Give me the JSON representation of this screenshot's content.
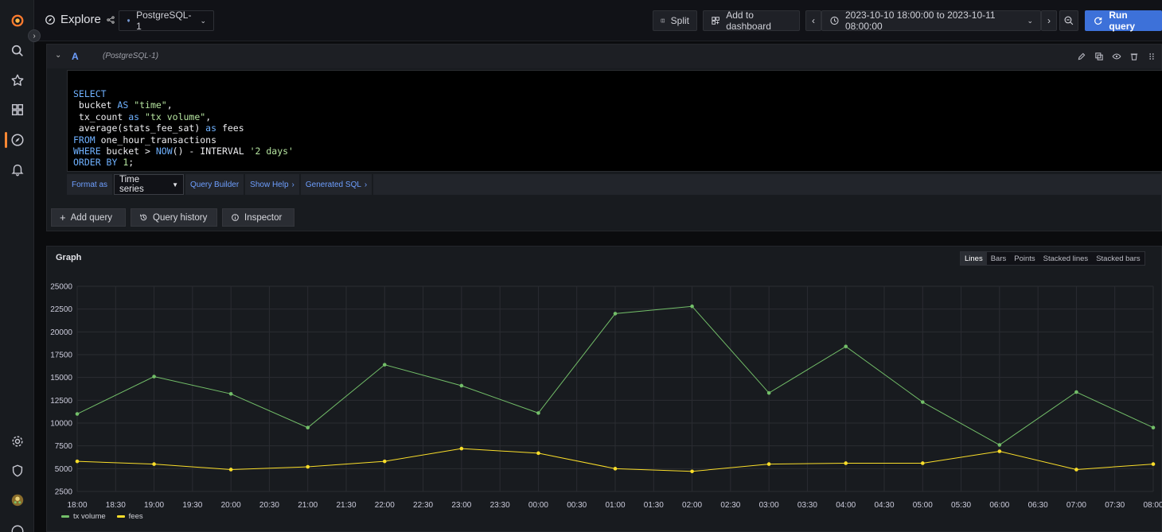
{
  "topbar": {
    "title": "Explore",
    "datasource": "PostgreSQL-1",
    "split_label": "Split",
    "add_dashboard_label": "Add to dashboard",
    "time_range": "2023-10-10 18:00:00 to 2023-10-11 08:00:00",
    "run_label": "Run query"
  },
  "query": {
    "ref_id": "A",
    "datasource_label": "(PostgreSQL-1)",
    "format_as_label": "Format as",
    "format_value": "Time series",
    "builder_label": "Query Builder",
    "help_label": "Show Help",
    "generated_sql_label": "Generated SQL",
    "add_query_label": "Add query",
    "history_label": "Query history",
    "inspector_label": "Inspector"
  },
  "graph": {
    "title": "Graph",
    "view_types": [
      "Lines",
      "Bars",
      "Points",
      "Stacked lines",
      "Stacked bars"
    ],
    "active_view": "Lines"
  },
  "colors": {
    "tx_volume": "#73bf69",
    "fees": "#fade2a",
    "accent": "#3d71d9"
  },
  "chart_data": {
    "type": "line",
    "x": [
      "18:00",
      "19:00",
      "20:00",
      "21:00",
      "22:00",
      "23:00",
      "00:00",
      "01:00",
      "02:00",
      "03:00",
      "04:00",
      "05:00",
      "06:00",
      "07:00",
      "08:00"
    ],
    "x_tick_labels": [
      "18:00",
      "18:30",
      "19:00",
      "19:30",
      "20:00",
      "20:30",
      "21:00",
      "21:30",
      "22:00",
      "22:30",
      "23:00",
      "23:30",
      "00:00",
      "00:30",
      "01:00",
      "01:30",
      "02:00",
      "02:30",
      "03:00",
      "03:30",
      "04:00",
      "04:30",
      "05:00",
      "05:30",
      "06:00",
      "06:30",
      "07:00",
      "07:30",
      "08:00"
    ],
    "y_ticks": [
      2500,
      5000,
      7500,
      10000,
      12500,
      15000,
      17500,
      20000,
      22500,
      25000
    ],
    "ylim": [
      2500,
      25000
    ],
    "grid": true,
    "legend_position": "bottom-left",
    "series": [
      {
        "name": "tx volume",
        "values": [
          11000,
          15100,
          13200,
          9500,
          16400,
          14100,
          11100,
          22000,
          22800,
          13300,
          18400,
          12300,
          7600,
          13400,
          9500
        ]
      },
      {
        "name": "fees",
        "values": [
          5800,
          5500,
          4900,
          5200,
          5800,
          7200,
          6700,
          5000,
          4700,
          5500,
          5600,
          5600,
          6900,
          4900,
          5500
        ]
      }
    ]
  }
}
